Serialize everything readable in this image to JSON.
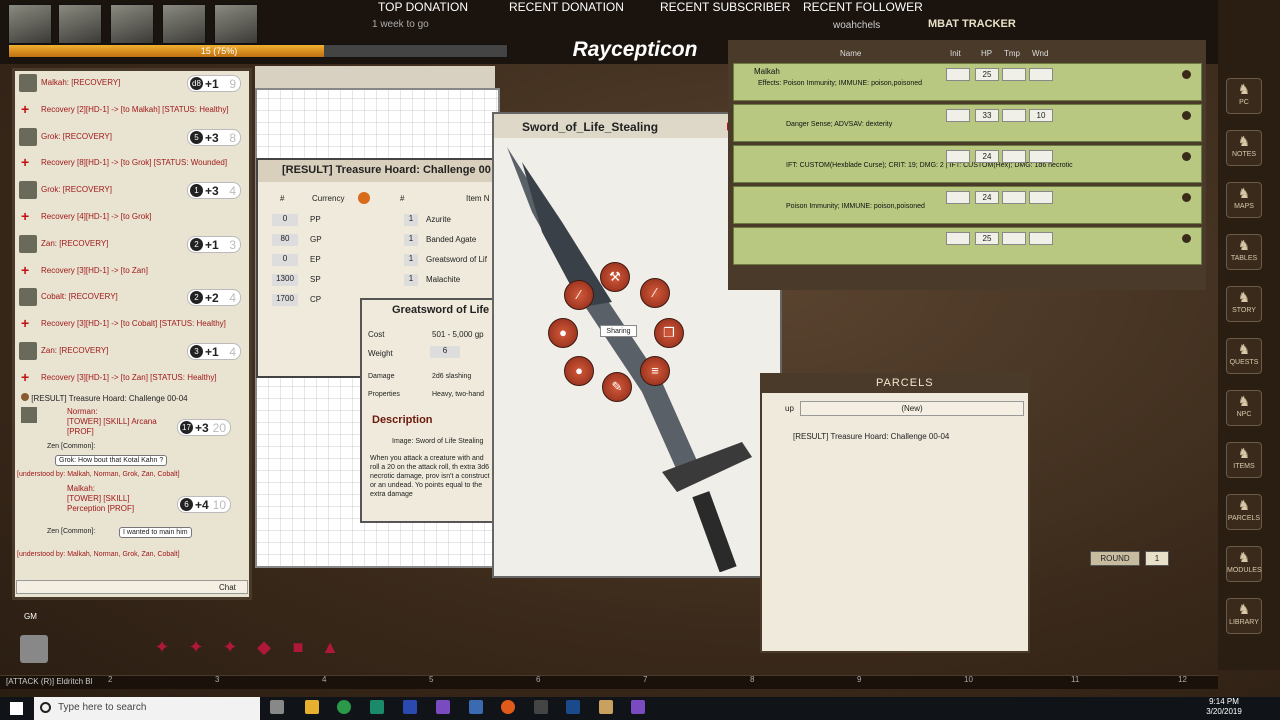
{
  "stream": {
    "top_donation_label": "TOP DONATION",
    "top_donation_value": "1 week to go",
    "recent_donation_label": "RECENT DONATION",
    "recent_subscriber_label": "RECENT SUBSCRIBER",
    "recent_follower_label": "RECENT FOLLOWER",
    "recent_follower_value": "woahchels",
    "brand": "Raycepticon"
  },
  "party": {
    "xp_text": "15 (75%)",
    "xp_fraction": 0.75
  },
  "chat": {
    "entries": [
      {
        "kind": "roll",
        "text": "Malkah: [RECOVERY]",
        "die": "d8",
        "mod": "+1",
        "total": "9"
      },
      {
        "kind": "recovery",
        "text": "Recovery [2][HD-1] -> [to Malkah] [STATUS: Healthy]"
      },
      {
        "kind": "roll",
        "text": "Grok: [RECOVERY]",
        "die": "5",
        "mod": "+3",
        "total": "8"
      },
      {
        "kind": "recovery",
        "text": "Recovery [8][HD-1] -> [to Grok] [STATUS: Wounded]"
      },
      {
        "kind": "roll",
        "text": "Grok: [RECOVERY]",
        "die": "1",
        "mod": "+3",
        "total": "4"
      },
      {
        "kind": "recovery",
        "text": "Recovery [4][HD-1] -> [to Grok]"
      },
      {
        "kind": "roll",
        "text": "Zan: [RECOVERY]",
        "die": "2",
        "mod": "+1",
        "total": "3"
      },
      {
        "kind": "recovery",
        "text": "Recovery [3][HD-1] -> [to Zan]"
      },
      {
        "kind": "roll",
        "text": "Cobalt: [RECOVERY]",
        "die": "2",
        "mod": "+2",
        "total": "4"
      },
      {
        "kind": "recovery",
        "text": "Recovery [3][HD-1] -> [to Cobalt] [STATUS: Healthy]"
      },
      {
        "kind": "roll",
        "text": "Zan: [RECOVERY]",
        "die": "3",
        "mod": "+1",
        "total": "4"
      },
      {
        "kind": "recovery",
        "text": "Recovery [3][HD-1] -> [to Zan] [STATUS: Healthy]"
      }
    ],
    "result_line": "[RESULT] Treasure Hoard: Challenge 00-04",
    "norman_name": "Norman:",
    "norman_skill": "[TOWER] [SKILL] Arcana [PROF]",
    "norman_mod": "+3",
    "norman_total": "20",
    "norman_die": "17",
    "zen_common": "Zen [Common]:",
    "grok_speech": "Grok: How bout that Kotal Kahn ?",
    "understood_1": "[understood by: Malkah, Norman, Grok, Zan, Cobalt]",
    "malkah_name": "Malkah:",
    "malkah_skill": "[TOWER] [SKILL] Perception [PROF]",
    "malkah_mod": "+4",
    "malkah_total": "10",
    "malkah_die": "6",
    "zen_common_2": "Zen [Common]:",
    "zen_speech": "I wanted to main him",
    "understood_2": "[understood by: Malkah, Norman, Grok, Zan, Cobalt]",
    "chat_button": "Chat"
  },
  "treasure": {
    "title": "[RESULT] Treasure Hoard: Challenge 00",
    "currency_header": "Currency",
    "item_header": "Item N",
    "count_header": "#",
    "currency": [
      {
        "amount": "0",
        "type": "PP"
      },
      {
        "amount": "80",
        "type": "GP"
      },
      {
        "amount": "0",
        "type": "EP"
      },
      {
        "amount": "1300",
        "type": "SP"
      },
      {
        "amount": "1700",
        "type": "CP"
      }
    ],
    "items": [
      {
        "count": "1",
        "name": "Azurite"
      },
      {
        "count": "1",
        "name": "Banded Agate"
      },
      {
        "count": "1",
        "name": "Greatsword of Lif"
      },
      {
        "count": "1",
        "name": "Malachite"
      }
    ]
  },
  "item_detail": {
    "title": "Greatsword of Life",
    "cost_label": "Cost",
    "cost_value": "501 - 5,000 gp",
    "weight_label": "Weight",
    "weight_value": "6",
    "damage_label": "Damage",
    "damage_value": "2d6 slashing",
    "properties_label": "Properties",
    "properties_value": "Heavy, two-hand",
    "description_header": "Description",
    "image_link": "Image: Sword of Life Stealing",
    "description_text": "When you attack a creature with and roll a 20 on the attack roll, th extra 3d6 necrotic damage, prov isn't a construct or an undead. Yo points equal to the extra damage"
  },
  "sword_window": {
    "title": "Sword_of_Life_Stealing",
    "sharing_label": "Sharing"
  },
  "combat_tracker": {
    "title": "MBAT TRACKER",
    "col_name": "Name",
    "col_init": "Init",
    "col_hp": "HP",
    "col_tmp": "Tmp",
    "col_wnd": "Wnd",
    "rows": [
      {
        "name": "Malkah",
        "effects": "Effects: Poison Immunity; IMMUNE: poison,poisoned",
        "hp": "25",
        "wnd": ""
      },
      {
        "name": "",
        "effects": "Danger Sense; ADVSAV: dexterity",
        "hp": "33",
        "wnd": "10"
      },
      {
        "name": "",
        "effects": "IFT: CUSTOM(Hexblade Curse); CRIT: 19; DMG: 2 | IFT: CUSTOM(Hex); DMG: 1d6 necrotic",
        "hp": "24",
        "wnd": ""
      },
      {
        "name": "",
        "effects": "Poison Immunity; IMMUNE: poison,poisoned",
        "hp": "24",
        "wnd": ""
      },
      {
        "name": "",
        "effects": "",
        "hp": "25",
        "wnd": ""
      }
    ]
  },
  "parcels": {
    "title": "PARCELS",
    "dropdown_label": "up",
    "dropdown_value": "(New)",
    "item": "[RESULT] Treasure Hoard: Challenge 00-04"
  },
  "round": {
    "label": "ROUND",
    "value": "1"
  },
  "sidebar": [
    "PC",
    "NOTES",
    "MAPS",
    "TABLES",
    "STORY",
    "QUESTS",
    "NPC",
    "ITEMS",
    "PARCELS",
    "MODULES",
    "LIBRARY"
  ],
  "gm_label": "GM",
  "hotbar": {
    "text": "[ATTACK (R)] Eldritch Bl",
    "numbers": [
      "2",
      "3",
      "4",
      "5",
      "6",
      "7",
      "8",
      "9",
      "10",
      "11",
      "12"
    ]
  },
  "taskbar": {
    "search_placeholder": "Type here to search",
    "time": "9:14 PM",
    "date": "3/20/2019"
  }
}
